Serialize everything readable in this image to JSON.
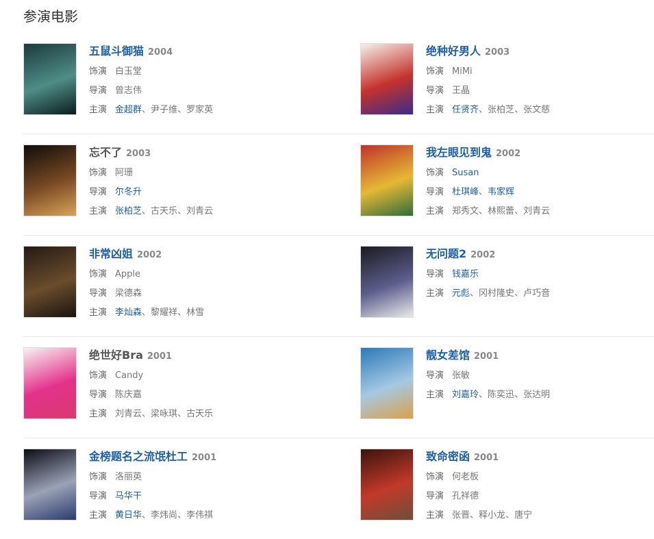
{
  "page": {
    "title": "参演电影"
  },
  "labels": {
    "role": "饰演",
    "director": "导演",
    "cast": "主演"
  },
  "colors": {
    "link": "#1f5fa6",
    "text": "#777777",
    "divider": "#e8e8e8"
  },
  "movies": [
    {
      "title": "五鼠斗御猫",
      "title_link": true,
      "year": "2004",
      "role": {
        "text": "白玉堂",
        "link": false
      },
      "directors": [
        {
          "text": "曾志伟",
          "link": false
        }
      ],
      "cast": [
        {
          "text": "金超群",
          "link": true
        },
        {
          "text": "尹子维",
          "link": false
        },
        {
          "text": "罗家英",
          "link": false
        }
      ],
      "poster_colors": [
        "#1b3a3d",
        "#4f8d86",
        "#0b1c1e"
      ]
    },
    {
      "title": "绝种好男人",
      "title_link": true,
      "year": "2003",
      "role": {
        "text": "MiMi",
        "link": false
      },
      "directors": [
        {
          "text": "王晶",
          "link": false
        }
      ],
      "cast": [
        {
          "text": "任贤齐",
          "link": true
        },
        {
          "text": "张柏芝",
          "link": false
        },
        {
          "text": "张文慈",
          "link": false
        }
      ],
      "poster_colors": [
        "#f4f2e9",
        "#c5322d",
        "#3b2c8a"
      ]
    },
    {
      "title": "忘不了",
      "title_link": false,
      "year": "2003",
      "role": {
        "text": "阿珊",
        "link": false
      },
      "directors": [
        {
          "text": "尔冬升",
          "link": true
        }
      ],
      "cast": [
        {
          "text": "张柏芝",
          "link": true
        },
        {
          "text": "古天乐",
          "link": false
        },
        {
          "text": "刘青云",
          "link": false
        }
      ],
      "poster_colors": [
        "#0f0c0a",
        "#7a4a24",
        "#d9a45a"
      ]
    },
    {
      "title": "我左眼见到鬼",
      "title_link": true,
      "year": "2002",
      "role": {
        "text": "Susan",
        "link": true
      },
      "directors": [
        {
          "text": "杜琪峰",
          "link": true
        },
        {
          "text": "韦家辉",
          "link": true
        }
      ],
      "cast": [
        {
          "text": "郑秀文",
          "link": false
        },
        {
          "text": "林熙蕾",
          "link": false
        },
        {
          "text": "刘青云",
          "link": false
        }
      ],
      "poster_colors": [
        "#c0322a",
        "#e6b834",
        "#2f6e3a"
      ]
    },
    {
      "title": "非常凶姐",
      "title_link": true,
      "year": "2002",
      "role": {
        "text": "Apple",
        "link": false
      },
      "directors": [
        {
          "text": "梁德森",
          "link": false
        }
      ],
      "cast": [
        {
          "text": "李灿森",
          "link": true
        },
        {
          "text": "黎耀祥",
          "link": false
        },
        {
          "text": "林雪",
          "link": false
        }
      ],
      "poster_colors": [
        "#231a14",
        "#6a4d2c",
        "#1a1411"
      ]
    },
    {
      "title": "无问题2",
      "title_link": true,
      "year": "2002",
      "role": null,
      "directors": [
        {
          "text": "钱嘉乐",
          "link": true
        }
      ],
      "cast": [
        {
          "text": "元彪",
          "link": true
        },
        {
          "text": "冈村隆史",
          "link": false
        },
        {
          "text": "卢巧音",
          "link": false
        }
      ],
      "poster_colors": [
        "#1b1b21",
        "#5c5d8c",
        "#eaeaea"
      ]
    },
    {
      "title": "绝世好Bra",
      "title_link": false,
      "year": "2001",
      "role": {
        "text": "Candy",
        "link": false
      },
      "directors": [
        {
          "text": "陈庆嘉",
          "link": false
        }
      ],
      "cast": [
        {
          "text": "刘青云",
          "link": false
        },
        {
          "text": "梁咏琪",
          "link": false
        },
        {
          "text": "古天乐",
          "link": false
        }
      ],
      "poster_colors": [
        "#f6f3f2",
        "#e4328b",
        "#d83a70"
      ]
    },
    {
      "title": "靓女差馆",
      "title_link": true,
      "year": "2001",
      "role": null,
      "directors": [
        {
          "text": "张敏",
          "link": false
        }
      ],
      "cast": [
        {
          "text": "刘嘉玲",
          "link": true
        },
        {
          "text": "陈奕迅",
          "link": false
        },
        {
          "text": "张达明",
          "link": false
        }
      ],
      "poster_colors": [
        "#2b7ab8",
        "#a6c8e3",
        "#d9a14c"
      ]
    },
    {
      "title": "金榜题名之流氓杜工",
      "title_link": true,
      "year": "2001",
      "role": {
        "text": "洛丽英",
        "link": false
      },
      "directors": [
        {
          "text": "马华干",
          "link": true
        }
      ],
      "cast": [
        {
          "text": "黄日华",
          "link": true
        },
        {
          "text": "李炜尚",
          "link": false
        },
        {
          "text": "李伟祺",
          "link": false
        }
      ],
      "poster_colors": [
        "#0c0d15",
        "#9aa2b6",
        "#2b3b6e"
      ]
    },
    {
      "title": "致命密函",
      "title_link": true,
      "year": "2001",
      "role": {
        "text": "何老板",
        "link": false
      },
      "directors": [
        {
          "text": "孔祥德",
          "link": false
        }
      ],
      "cast": [
        {
          "text": "张晋",
          "link": false
        },
        {
          "text": "释小龙",
          "link": false
        },
        {
          "text": "唐宁",
          "link": false
        }
      ],
      "poster_colors": [
        "#3b140c",
        "#c2392a",
        "#6e4f3a"
      ]
    }
  ]
}
